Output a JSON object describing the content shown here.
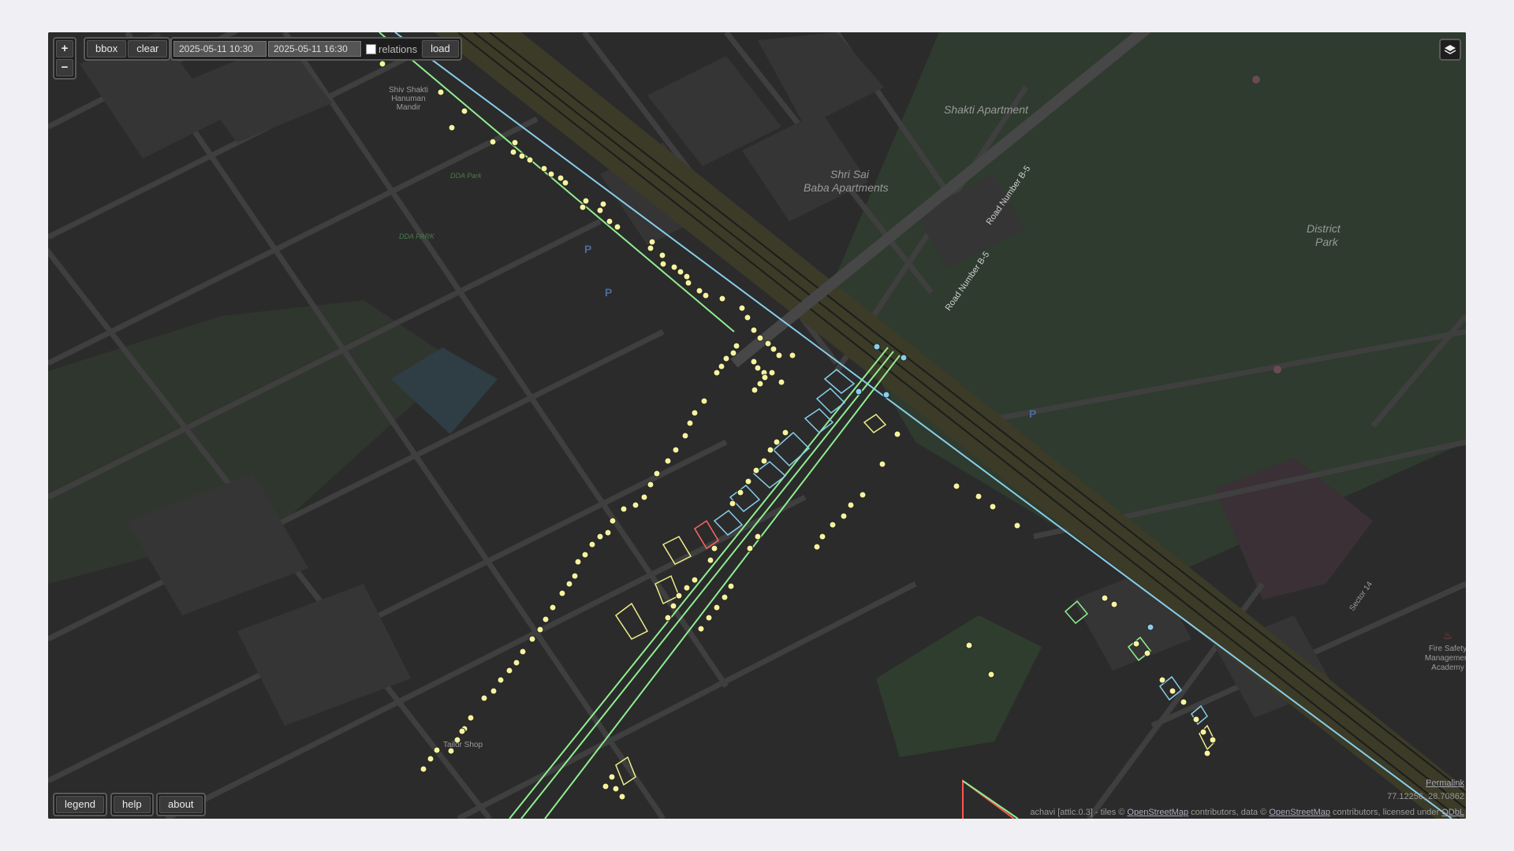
{
  "toolbar": {
    "zoom_in": "+",
    "zoom_out": "−",
    "bbox": "bbox",
    "clear": "clear",
    "date_from": "2025-05-11 10:30",
    "date_to": "2025-05-11 16:30",
    "relations": "relations",
    "load": "load"
  },
  "bottom": {
    "legend": "legend",
    "help": "help",
    "about": "about"
  },
  "footer": {
    "permalink": "Permalink",
    "coords": "77.12256, 28.70862",
    "attrib_app": "achavi [attic.0.3]",
    "attrib_tiles": " - tiles © ",
    "osm1": "OpenStreetMap",
    "attrib_mid": " contributors, data © ",
    "osm2": "OpenStreetMap",
    "attrib_end": " contributors, licensed under ",
    "odbl": "ODbL"
  },
  "map_labels": {
    "shakti": "Shakti Apartment",
    "shri_sai_1": "Shri Sai",
    "shri_sai_2": "Baba Apartments",
    "district_1": "District",
    "district_2": "Park",
    "road_b5_a": "Road Number B-5",
    "road_b5_b": "Road Number B-5",
    "mandir_1": "Shiv Shakti",
    "mandir_2": "Hanuman",
    "mandir_3": "Mandir",
    "ddapark1": "DDA Park",
    "ddapark2": "DDA PARK",
    "tailor": "Tailor Shop",
    "fire_1": "Fire Safety",
    "fire_2": "Management",
    "fire_3": "Academy",
    "sector": "Sector 14"
  },
  "colors": {
    "background": "#2b2b2b",
    "block": "#333333",
    "road": "#3d3d3d",
    "park": "#2f4a2f",
    "rail": "#454530",
    "node": "#f6f3a0",
    "way_green": "#90ee90",
    "way_blue": "#87ceeb",
    "way_yellow": "#eeee88"
  }
}
